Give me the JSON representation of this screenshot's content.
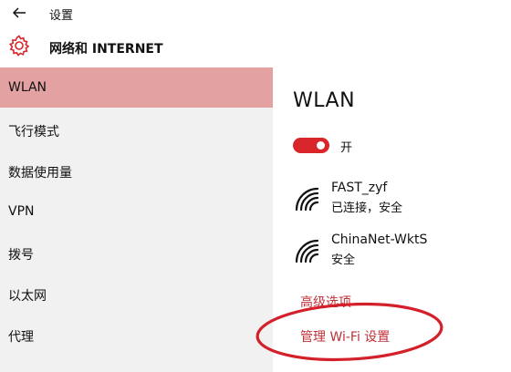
{
  "window": {
    "title": "设置"
  },
  "header": {
    "title": "网络和 INTERNET"
  },
  "sidebar": {
    "items": [
      {
        "label": "WLAN",
        "active": true
      },
      {
        "label": "飞行模式"
      },
      {
        "label": "数据使用量"
      },
      {
        "label": "VPN"
      },
      {
        "label": "拨号"
      },
      {
        "label": "以太网"
      },
      {
        "label": "代理"
      }
    ]
  },
  "main": {
    "heading": "WLAN",
    "toggle_label": "开",
    "toggle_on": true,
    "networks": [
      {
        "name": "FAST_zyf",
        "status": "已连接，安全"
      },
      {
        "name": "ChinaNet-WktS",
        "status": "安全"
      }
    ],
    "links": {
      "advanced": "高级选项",
      "manage": "管理 Wi-Fi 设置"
    }
  },
  "colors": {
    "accent": "#d9262a",
    "active_item": "#e3a1a2",
    "link": "#c0313a",
    "annotation": "#d4202a"
  },
  "icons": [
    "back-arrow-icon",
    "gear-icon",
    "wifi-signal-icon"
  ]
}
